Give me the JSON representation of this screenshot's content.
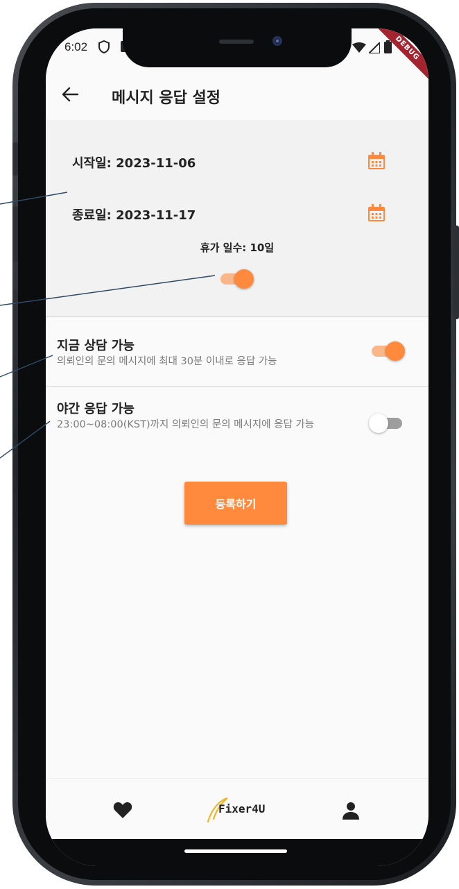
{
  "status_bar": {
    "time": "6:02",
    "debug_label": "DEBUG"
  },
  "app_bar": {
    "title": "메시지 응답 설정",
    "back_icon": "arrow-left-icon"
  },
  "vacation": {
    "start_label": "시작일: 2023-11-06",
    "end_label": "종료일: 2023-11-17",
    "days_label": "휴가 일수: 10일",
    "enabled": true,
    "calendar_icon": "calendar-icon"
  },
  "options": [
    {
      "title": "지금 상담 가능",
      "description": "의뢰인의 문의 메시지에 최대 30분 이내로 응답 가능",
      "enabled": true
    },
    {
      "title": "야간 응답 가능",
      "description": "23:00~08:00(KST)까지 의뢰인의 문의 메시지에 응답 가능",
      "enabled": false
    }
  ],
  "actions": {
    "register_label": "등록하기"
  },
  "bottom_nav": {
    "left_icon": "heart-icon",
    "logo_text": "Fixer4U",
    "right_icon": "person-icon"
  },
  "colors": {
    "accent": "#ff8a3d",
    "accent_light": "#f8b689",
    "background": "#fafafa",
    "section_bg": "#f2f2f2",
    "callout_line": "#2e4a66"
  }
}
